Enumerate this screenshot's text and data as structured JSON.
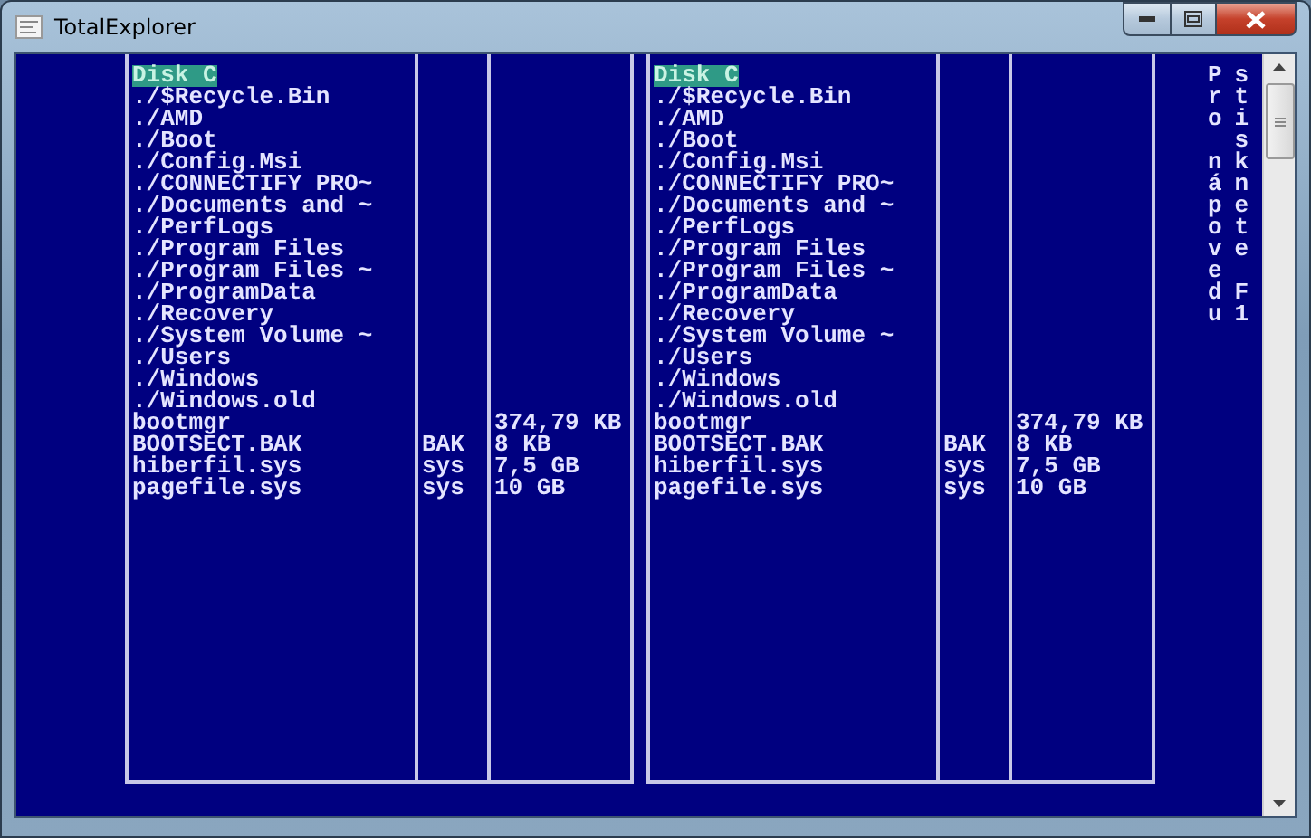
{
  "window": {
    "title": "TotalExplorer"
  },
  "panels": [
    {
      "drive": {
        "label": "Disk C",
        "selected": true
      },
      "entries": [
        {
          "name": "./$Recycle.Bin"
        },
        {
          "name": "./AMD"
        },
        {
          "name": "./Boot"
        },
        {
          "name": "./Config.Msi"
        },
        {
          "name": "./CONNECTIFY PRO~"
        },
        {
          "name": "./Documents and ~"
        },
        {
          "name": "./PerfLogs"
        },
        {
          "name": "./Program Files"
        },
        {
          "name": "./Program Files ~"
        },
        {
          "name": "./ProgramData"
        },
        {
          "name": "./Recovery"
        },
        {
          "name": "./System Volume ~"
        },
        {
          "name": "./Users"
        },
        {
          "name": "./Windows"
        },
        {
          "name": "./Windows.old"
        },
        {
          "name": "bootmgr",
          "size": "374,79 KB"
        },
        {
          "name": "BOOTSECT.BAK",
          "ext": "BAK",
          "size": "8 KB"
        },
        {
          "name": "hiberfil.sys",
          "ext": "sys",
          "size": "7,5 GB"
        },
        {
          "name": "pagefile.sys",
          "ext": "sys",
          "size": "10 GB"
        }
      ]
    },
    {
      "drive": {
        "label": "Disk C",
        "selected": true
      },
      "entries": [
        {
          "name": "./$Recycle.Bin"
        },
        {
          "name": "./AMD"
        },
        {
          "name": "./Boot"
        },
        {
          "name": "./Config.Msi"
        },
        {
          "name": "./CONNECTIFY PRO~"
        },
        {
          "name": "./Documents and ~"
        },
        {
          "name": "./PerfLogs"
        },
        {
          "name": "./Program Files"
        },
        {
          "name": "./Program Files ~"
        },
        {
          "name": "./ProgramData"
        },
        {
          "name": "./Recovery"
        },
        {
          "name": "./System Volume ~"
        },
        {
          "name": "./Users"
        },
        {
          "name": "./Windows"
        },
        {
          "name": "./Windows.old"
        },
        {
          "name": "bootmgr",
          "size": "374,79 KB"
        },
        {
          "name": "BOOTSECT.BAK",
          "ext": "BAK",
          "size": "8 KB"
        },
        {
          "name": "hiberfil.sys",
          "ext": "sys",
          "size": "7,5 GB"
        },
        {
          "name": "pagefile.sys",
          "ext": "sys",
          "size": "10 GB"
        }
      ]
    }
  ],
  "help_columns": [
    "Pro nápovedu",
    "stisknete F1"
  ]
}
